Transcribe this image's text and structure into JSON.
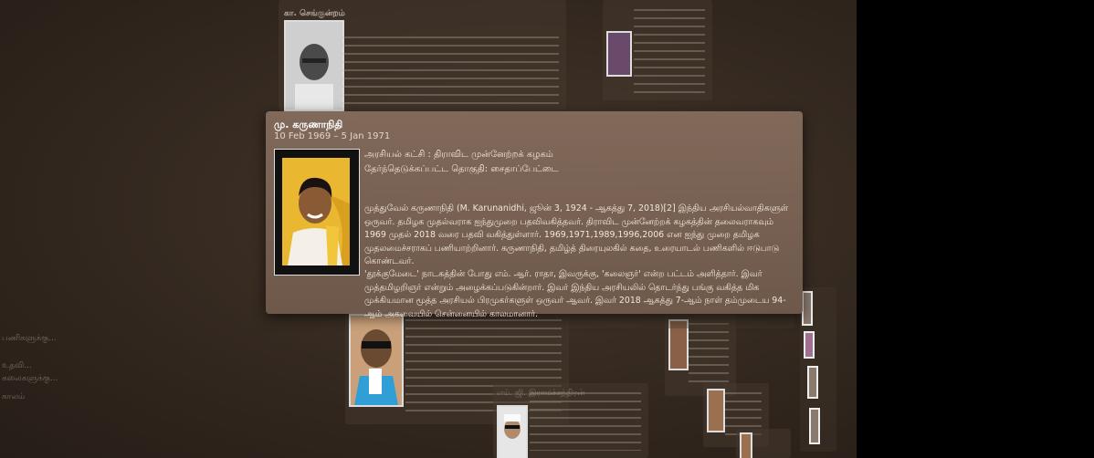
{
  "tooltip": {
    "name": "மு. கருணாநிதி",
    "term": "10 Feb 1969 – 5 Jan 1971",
    "party_line": "அரசியல் கட்சி : திராவிட முன்னேற்றக் கழகம்",
    "constituency_line": "தேர்ந்தெடுக்கப்பட்ட தொகுதி: சைதாப்பேட்டை",
    "bio_paragraph_1": "முத்துவேல் கருணாநிதி (M. Karunanidhi, ஜூன் 3, 1924 - ஆகத்து 7, 2018)[2] இந்திய அரசியல்வாதிகளுள் ஒருவர். தமிழக முதல்வராக ஐந்துமுறை பதவிவகித்தவர். திராவிட முன்னேற்றக் கழகத்தின் தலைவராகவும் 1969 முதல் 2018 வரை பதவி வகித்துள்ளார். 1969,1971,1989,1996,2006 என ஐந்து முறை தமிழக முதலமைச்சராகப் பணியாற்றினார். கருணாநிதி, தமிழ்த் திரையுலகில் கதை, உரையாடல் பணிகளில் ஈடுபாடு கொண்டவர்.",
    "bio_paragraph_2": "'தூக்குமேடை' நாடகத்தின் போது எம். ஆர். ராதா, இவருக்கு, 'கலைஞர்' என்ற பட்டம் அளித்தார். இவர் முத்தமிழறிஞர் என்றும் அழைக்கப்படுகின்றார். இவர் இந்திய அரசியலில் தொடர்ந்து பங்கு வகித்த மிக முக்கியமான மூத்த அரசியல் பிரமுகர்களுள் ஒருவர் ஆவர். இவர் 2018 ஆகத்து 7-ஆம் நாள் தம்முடைய 94-ஆம் அகவையில் சென்னையில் காலமானார்."
  },
  "background": {
    "top_card_heading": "கா. செங்குன்றம்",
    "bottom_card_heading": "எம். ஜி. இராமச்சந்திரன்",
    "left_text_1": "பணிகளுக்கு...",
    "left_text_2": "உதவி...",
    "left_text_3": "கலைகளுக்கு...",
    "left_text_4": "காலம்"
  },
  "colors": {
    "background": "#33281f",
    "tooltip": "#7d6655",
    "outer": "#000000",
    "portrait_frame": "#f3c93a"
  },
  "icons": {
    "portrait": "person-portrait"
  }
}
